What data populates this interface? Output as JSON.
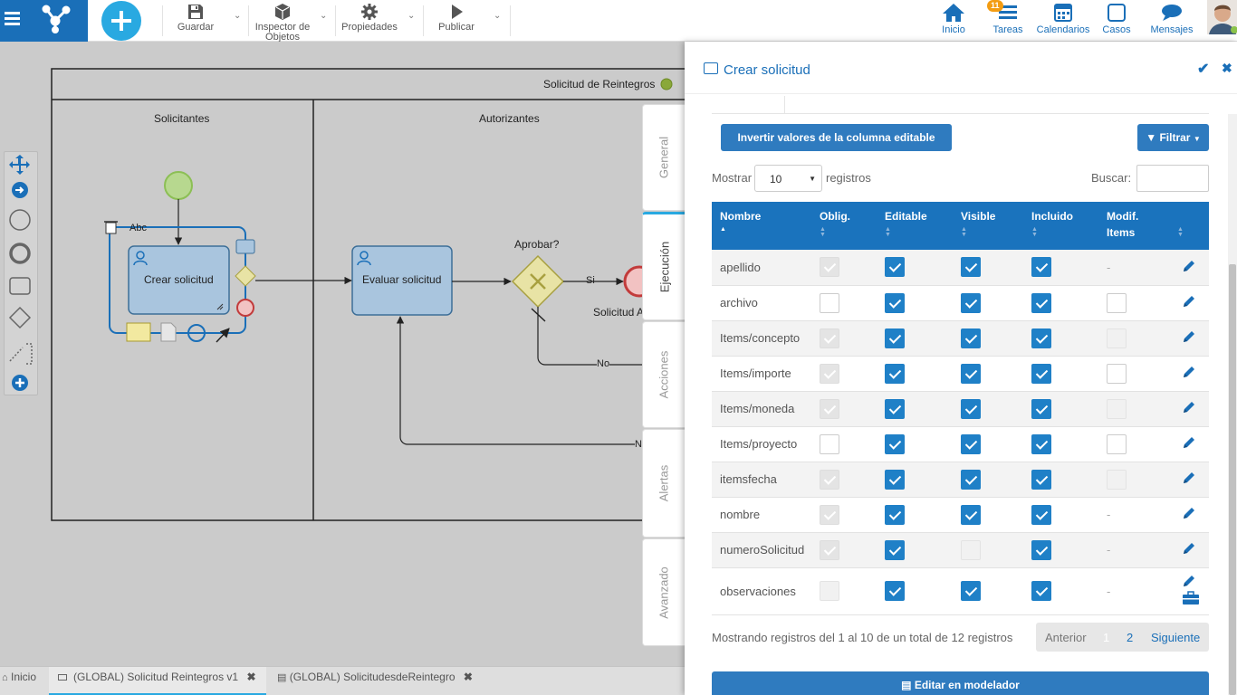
{
  "toolbar": {
    "save": "Guardar",
    "inspector_line1": "Inspector de",
    "inspector_line2": "Objetos",
    "properties": "Propiedades",
    "publish": "Publicar"
  },
  "topnav": {
    "home": "Inicio",
    "tasks": "Tareas",
    "tasks_badge": "11",
    "calendars": "Calendarios",
    "cases": "Casos",
    "messages": "Mensajes"
  },
  "diagram": {
    "pool_name": "Solicitud de Reintegros",
    "lane_1": "Solicitantes",
    "lane_2": "Autorizantes",
    "task_1": "Crear solicitud",
    "task_2": "Evaluar solicitud",
    "gateway_label": "Aprobar?",
    "flow_yes": "Si",
    "flow_no": "No",
    "flow_n": "N",
    "end_label": "Solicitud A",
    "text_tool": "Abc"
  },
  "side_tabs": [
    "General",
    "Ejecución",
    "Acciones",
    "Alertas",
    "Avanzado"
  ],
  "panel": {
    "title": "Crear solicitud",
    "invert_button": "Invertir valores de la columna editable",
    "filter_button": "Filtrar",
    "show_label": "Mostrar",
    "page_size": "10",
    "records_label": "registros",
    "search_label": "Buscar:",
    "search_value": "",
    "columns": [
      "Nombre",
      "Oblig.",
      "Editable",
      "Visible",
      "Incluido",
      "Modif.",
      "Items"
    ],
    "footer_info": "Mostrando registros del 1 al 10 de un total de 12 registros",
    "prev": "Anterior",
    "page_1": "1",
    "page_2": "2",
    "next": "Siguiente",
    "edit_modeler": "Editar en modelador"
  },
  "rows": [
    {
      "name": "apellido",
      "oblig": true,
      "oblig_disabled": true,
      "editable": true,
      "visible": true,
      "included": true,
      "modif": "-"
    },
    {
      "name": "archivo",
      "oblig": false,
      "oblig_disabled": false,
      "editable": true,
      "visible": true,
      "included": true,
      "modif": "box"
    },
    {
      "name": "Items/concepto",
      "oblig": true,
      "oblig_disabled": true,
      "editable": true,
      "visible": true,
      "included": true,
      "modif": "box-disabled"
    },
    {
      "name": "Items/importe",
      "oblig": true,
      "oblig_disabled": true,
      "editable": true,
      "visible": true,
      "included": true,
      "modif": "box"
    },
    {
      "name": "Items/moneda",
      "oblig": true,
      "oblig_disabled": true,
      "editable": true,
      "visible": true,
      "included": true,
      "modif": "box-disabled"
    },
    {
      "name": "Items/proyecto",
      "oblig": false,
      "oblig_disabled": false,
      "editable": true,
      "visible": true,
      "included": true,
      "modif": "box"
    },
    {
      "name": "itemsfecha",
      "oblig": true,
      "oblig_disabled": true,
      "editable": true,
      "visible": true,
      "included": true,
      "modif": "box-disabled"
    },
    {
      "name": "nombre",
      "oblig": true,
      "oblig_disabled": true,
      "editable": true,
      "visible": true,
      "included": true,
      "modif": "-"
    },
    {
      "name": "numeroSolicitud",
      "oblig": true,
      "oblig_disabled": true,
      "editable": true,
      "visible": false,
      "visible_disabled": true,
      "included": true,
      "modif": "-"
    },
    {
      "name": "observaciones",
      "oblig": false,
      "oblig_disabled": true,
      "editable": true,
      "visible": true,
      "included": true,
      "modif": "-"
    }
  ],
  "bottom_tabs": {
    "home": "Inicio",
    "tab_1": "(GLOBAL) Solicitud Reintegros v1",
    "tab_2": "(GLOBAL) SolicitudesdeReintegro"
  },
  "colors": {
    "brand": "#1a6fb8",
    "accent": "#29a9e1",
    "header": "#1a73bd"
  }
}
